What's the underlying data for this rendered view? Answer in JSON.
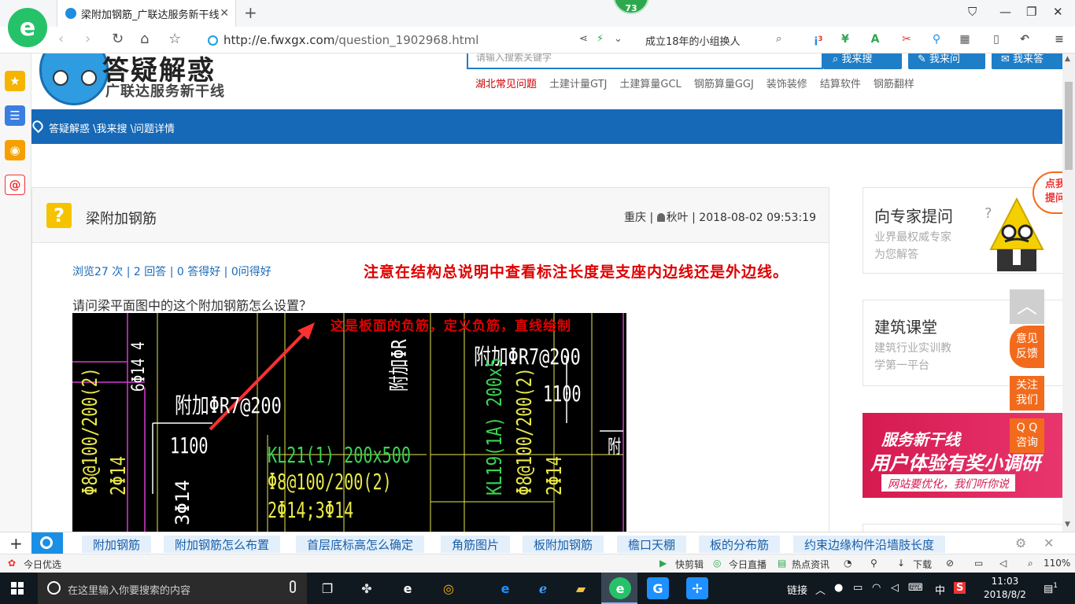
{
  "browser": {
    "tab_title": "梁附加钢筋_广联达服务新干线",
    "url_host": "http://e.fwxgx.com",
    "url_path": "/question_1902968.html",
    "badge_count": "73",
    "search_hint": "成立18年的小组换人",
    "ext_badge": "3"
  },
  "site": {
    "title": "答疑解惑",
    "subtitle": "广联达服务新干线",
    "search_placeholder": "请输入搜索关键字",
    "btn_search": "我来搜",
    "btn_ask": "我来问",
    "btn_answer": "我来答",
    "categories": [
      "湖北常见问题",
      "土建计量GTJ",
      "土建算量GCL",
      "钢筋算量GGJ",
      "装饰装修",
      "结算软件",
      "钢筋翻样"
    ],
    "breadcrumb": "答疑解惑 \\我来搜 \\问题详情"
  },
  "question": {
    "title": "梁附加钢筋",
    "region": "重庆",
    "user": "秋叶",
    "datetime": "2018-08-02 09:53:19",
    "stats": "浏览27 次 | 2 回答 | 0 答得好 | 0问得好",
    "red_note": "注意在结构总说明中查看标注长度是支座内边线还是外边线。",
    "text": "请问梁平面图中的这个附加钢筋怎么设置？",
    "image_note": "这是板面的负筋，定义负筋，直线绘制",
    "cad_labels": {
      "add1": "附加ΦR7@200",
      "add2": "附加ΦR7@200",
      "len1": "1100",
      "len2": "1100",
      "beam1": "KL21(1) 200x500",
      "stirrup1": "Φ8@100/200(2)",
      "bars1": "2Φ14;3Φ14",
      "side": "3Φ14",
      "beam2": "KL19(1A) 200x5",
      "stirrup2": "Φ8@100/200(2)",
      "bars2": "2Φ14",
      "left1": "Φ8@100/200(2)",
      "left2": "2Φ14",
      "left3": "6Φ14 4",
      "top_vert": "附加ΦR",
      "right_cut": "附"
    }
  },
  "sidebar": {
    "expert_title": "向专家提问",
    "expert_desc1": "业界最权威专家",
    "expert_desc2": "为您解答",
    "class_title": "建筑课堂",
    "class_desc1": "建筑行业实训教",
    "class_desc2": "学第一平台",
    "banner_line1": "服务新干线",
    "banner_line2": "用户体验有奖小调研",
    "banner_line3": "网站要优化，我们听你说",
    "float_feedback": [
      "意见",
      "反馈"
    ],
    "float_follow": [
      "关注",
      "我们"
    ],
    "float_qq": [
      "Q Q",
      "咨询"
    ],
    "corner_tip": "点我提问"
  },
  "hot_words": [
    "附加钢筋",
    "附加钢筋怎么布置",
    "首层底标高怎么确定",
    "角筋图片",
    "板附加钢筋",
    "檐口天棚",
    "板的分布筋",
    "约束边缘构件沿墙肢长度"
  ],
  "status_bar": {
    "left": "今日优选",
    "items": [
      "快剪辑",
      "今日直播",
      "热点资讯",
      "下载"
    ],
    "zoom": "110%"
  },
  "taskbar": {
    "search_placeholder": "在这里输入你要搜索的内容",
    "tray_link": "链接",
    "ime": "中",
    "time": "11:03",
    "date": "2018/8/2",
    "notif": "1"
  },
  "colors": {
    "brand_blue": "#1669b7",
    "accent_orange": "#f26b1d",
    "red_note": "#e00000",
    "cad_green": "#39d353",
    "cad_yellow": "#e8e84a",
    "cad_white": "#ffffff",
    "cad_magenta": "#d63ad6"
  }
}
